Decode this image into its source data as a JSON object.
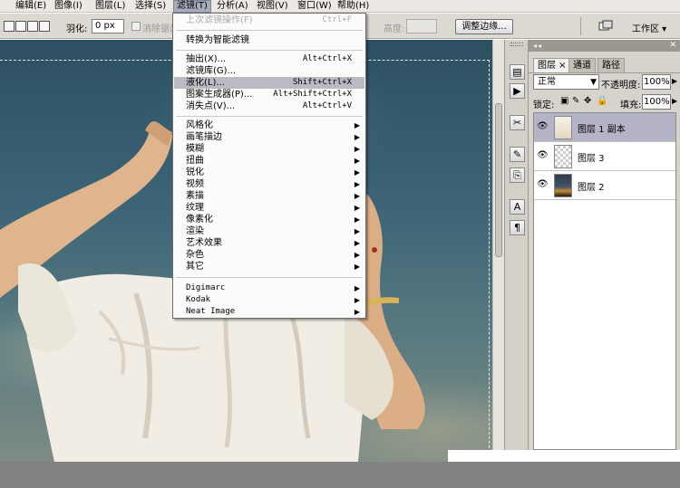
{
  "menubar": {
    "items": [
      "编辑(E)",
      "图像(I)",
      "图层(L)",
      "选择(S)",
      "滤镜(T)",
      "分析(A)",
      "视图(V)",
      "窗口(W)",
      "帮助(H)"
    ],
    "active_index": 4
  },
  "options_bar": {
    "feather_label": "羽化:",
    "feather_value": "0 px",
    "antialias_label": "消除锯齿",
    "height_label": "高度:",
    "refine_edge_button": "调整边缘...",
    "workspace_label": "工作区 ▾"
  },
  "filter_menu": {
    "last_filter": {
      "label": "上次滤镜操作(F)",
      "shortcut": "Ctrl+F"
    },
    "smart_filter": "转换为智能滤镜",
    "group1": [
      {
        "label": "抽出(X)...",
        "shortcut": "Alt+Ctrl+X"
      },
      {
        "label": "滤镜库(G)...",
        "shortcut": ""
      },
      {
        "label": "液化(L)...",
        "shortcut": "Shift+Ctrl+X"
      },
      {
        "label": "图案生成器(P)...",
        "shortcut": "Alt+Shift+Ctrl+X"
      },
      {
        "label": "消失点(V)...",
        "shortcut": "Alt+Ctrl+V"
      }
    ],
    "highlighted_index": 2,
    "submenus": [
      "风格化",
      "画笔描边",
      "模糊",
      "扭曲",
      "锐化",
      "视频",
      "素描",
      "纹理",
      "像素化",
      "渲染",
      "艺术效果",
      "杂色",
      "其它"
    ],
    "plugins": [
      "Digimarc",
      "Kodak",
      "Neat Image"
    ]
  },
  "layers_panel": {
    "tabs": [
      "图层 ×",
      "通道",
      "路径"
    ],
    "active_tab": 0,
    "blend_mode": "正常",
    "opacity_label": "不透明度:",
    "opacity_value": "100%",
    "lock_label": "锁定:",
    "fill_label": "填充:",
    "fill_value": "100%",
    "layers": [
      {
        "name": "图层 1 副本",
        "selected": true
      },
      {
        "name": "图层 3",
        "selected": false
      },
      {
        "name": "图层 2",
        "selected": false
      }
    ]
  },
  "icons": {
    "eye": "eye-icon",
    "lock": "lock-icon",
    "dock": [
      "history-icon",
      "actions-icon",
      "tools-icon",
      "brush-icon",
      "clone-icon",
      "character-icon",
      "paragraph-icon"
    ]
  },
  "colors": {
    "menu_highlight": "#b9bac2",
    "selected_layer": "#b4b3c7",
    "panel_bg": "#d6d3cc"
  }
}
